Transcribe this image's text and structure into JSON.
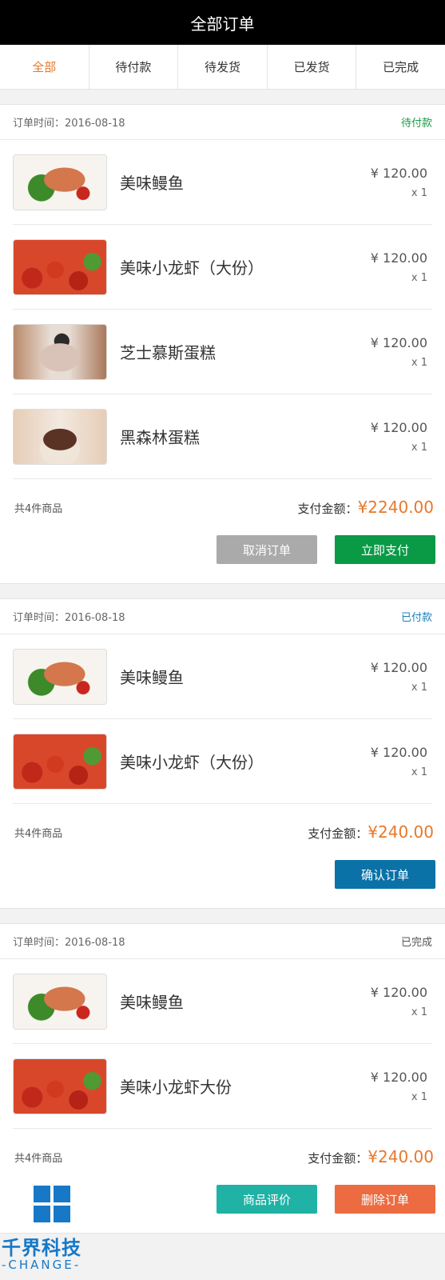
{
  "header": {
    "title": "全部订单"
  },
  "tabs": [
    {
      "label": "全部",
      "active": true
    },
    {
      "label": "待付款",
      "active": false
    },
    {
      "label": "待发货",
      "active": false
    },
    {
      "label": "已发货",
      "active": false
    },
    {
      "label": "已完成",
      "active": false
    }
  ],
  "orders": [
    {
      "time": "订单时间：2016-08-18",
      "status": "待付款",
      "status_color": "#1a9a4a",
      "items": [
        {
          "name": "美味鳗鱼",
          "price": "¥ 120.00",
          "qty": "x 1",
          "image": "grilled-fish-image"
        },
        {
          "name": "美味小龙虾（大份）",
          "price": "¥ 120.00",
          "qty": "x 1",
          "image": "crayfish-image"
        },
        {
          "name": "芝士慕斯蛋糕",
          "price": "¥ 120.00",
          "qty": "x 1",
          "image": "cheese-mousse-cake-image"
        },
        {
          "name": "黑森林蛋糕",
          "price": "¥ 120.00",
          "qty": "x 1",
          "image": "black-forest-cake-image"
        }
      ],
      "count": "共4件商品",
      "total_label": "支付金额：",
      "total": "¥2240.00",
      "buttons": [
        "取消订单",
        "立即支付"
      ]
    },
    {
      "time": "订单时间：2016-08-18",
      "status": "已付款",
      "status_color": "#1d7fb8",
      "items": [
        {
          "name": "美味鳗鱼",
          "price": "¥ 120.00",
          "qty": "x 1",
          "image": "grilled-fish-image"
        },
        {
          "name": "美味小龙虾（大份）",
          "price": "¥ 120.00",
          "qty": "x 1",
          "image": "crayfish-image"
        }
      ],
      "count": "共4件商品",
      "total_label": "支付金额：",
      "total": "¥240.00",
      "buttons": [
        "确认订单"
      ]
    },
    {
      "time": "订单时间：2016-08-18",
      "status": "已完成",
      "status_color": "#555555",
      "items": [
        {
          "name": "美味鳗鱼",
          "price": "¥ 120.00",
          "qty": "x 1",
          "image": "grilled-fish-image"
        },
        {
          "name": "美味小龙虾大份",
          "price": "¥ 120.00",
          "qty": "x 1",
          "image": "crayfish-image"
        }
      ],
      "count": "共4件商品",
      "total_label": "支付金额：",
      "total": "¥240.00",
      "buttons": [
        "商品评价",
        "删除订单"
      ]
    }
  ],
  "watermark": {
    "main": "千界科技",
    "sub": "-CHANGE-",
    "color": "#1778c8"
  },
  "colors": {
    "accent": "#e07a2f",
    "price_total": "#e8782a"
  }
}
